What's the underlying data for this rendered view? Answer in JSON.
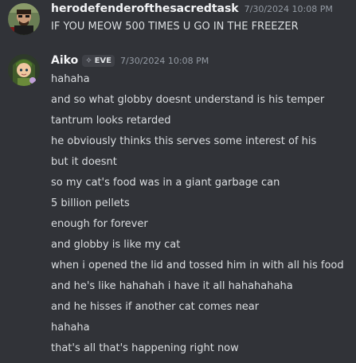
{
  "messages": [
    {
      "username": "herodefenderofthesacredtask",
      "timestamp": "7/30/2024 10:08 PM",
      "lines": [
        "IF YOU MEOW 500 TIMES U GO IN THE FREEZER"
      ]
    },
    {
      "username": "Aiko",
      "tag": "EVE",
      "tag_icon": "sparkle-icon",
      "timestamp": "7/30/2024 10:08 PM",
      "lines": [
        "hahaha",
        "and so what globby doesnt understand is his temper",
        "tantrum looks retarded",
        "he obviously thinks this serves some interest of his",
        "but it doesnt",
        "so my cat's food was in a giant garbage can",
        "5 billion pellets",
        "enough for forever",
        "and globby is like my cat",
        "when i opened the lid and tossed him in with all his food",
        "and he's like hahahah i have it all hahahahaha",
        "and he hisses if another cat comes near",
        "hahaha",
        "that's all that's happening right now"
      ]
    }
  ]
}
